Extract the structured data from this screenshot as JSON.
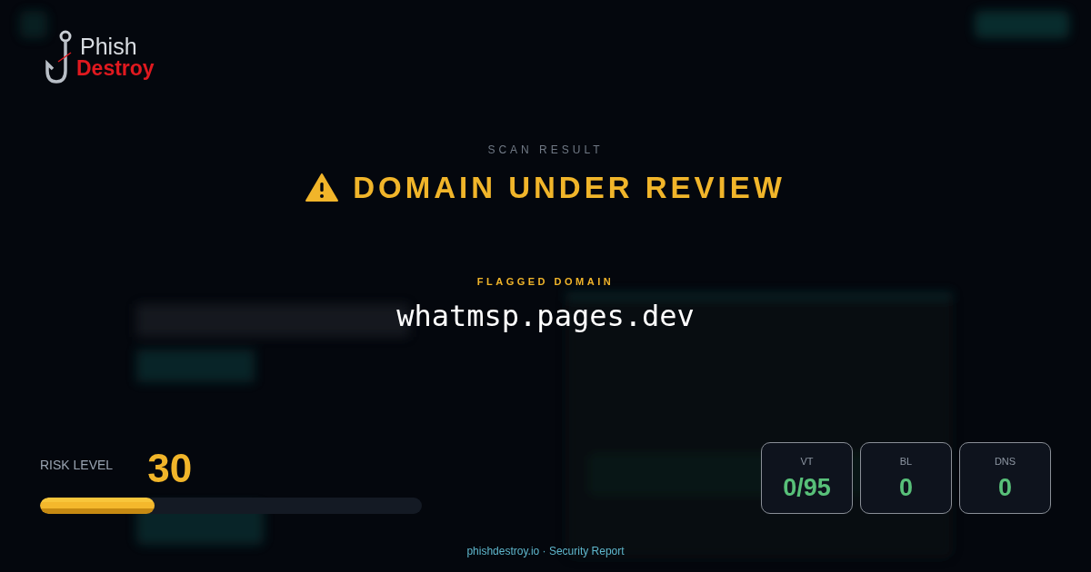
{
  "logo": {
    "line_1": "Phish",
    "line_2": "Destroy"
  },
  "eyebrow": "SCAN RESULT",
  "verdict": {
    "kind": "warning",
    "title": "DOMAIN UNDER REVIEW"
  },
  "domain_label": "FLAGGED DOMAIN",
  "domain": "whatmsp.pages.dev",
  "risk": {
    "label": "RISK LEVEL",
    "score": "30",
    "level": 0.3
  },
  "stats": [
    {
      "label": "VT",
      "value": "0/95"
    },
    {
      "label": "BL",
      "value": "0"
    },
    {
      "label": "DNS",
      "value": "0"
    }
  ],
  "footer": {
    "site": "phishdestroy.io",
    "separator": "·",
    "text": "Security Report"
  }
}
